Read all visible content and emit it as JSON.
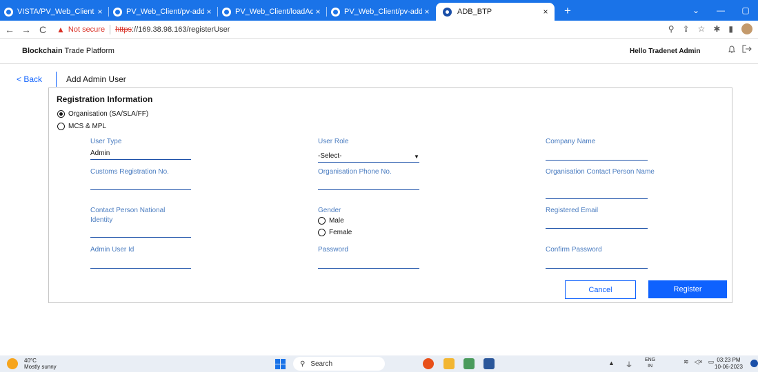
{
  "tabs": [
    {
      "title": "VISTA/PV_Web_Client at feat",
      "icon": "github-icon"
    },
    {
      "title": "PV_Web_Client/pv-address-",
      "icon": "github-icon"
    },
    {
      "title": "PV_Web_Client/loadAddress",
      "icon": "github-icon"
    },
    {
      "title": "PV_Web_Client/pv-address-",
      "icon": "github-icon"
    },
    {
      "title": "ADB_BTP",
      "icon": "app-favicon-icon"
    }
  ],
  "tab_close": "×",
  "new_tab": "+",
  "window_controls": {
    "dropdown": "⌄",
    "minimize": "—",
    "restore": "▢",
    "close": "✕"
  },
  "addressbar": {
    "back": "←",
    "forward": "→",
    "reload": "C",
    "security_text": "Not secure",
    "url_scheme": "https",
    "url_rest": "://169.38.98.163/registerUser"
  },
  "app": {
    "brand_bold": "Blockchain",
    "brand_rest": " Trade Platform",
    "greeting": "Hello Tradenet Admin"
  },
  "page": {
    "back_label": "< Back",
    "title": "Add Admin User"
  },
  "form": {
    "section_title": "Registration Information",
    "org_type_options": [
      {
        "label": "Organisation (SA/SLA/FF)",
        "selected": true
      },
      {
        "label": "MCS & MPL",
        "selected": false
      }
    ],
    "user_type": {
      "label": "User Type",
      "value": "Admin"
    },
    "user_role": {
      "label": "User Role",
      "value": "-Select-"
    },
    "company_name": {
      "label": "Company Name",
      "value": ""
    },
    "customs_registration": {
      "label": "Customs Registration No.",
      "value": ""
    },
    "org_phone": {
      "label": "Organisation Phone No.",
      "value": ""
    },
    "org_contact_person": {
      "label": "Organisation Contact Person Name",
      "value": ""
    },
    "contact_national_id": {
      "label": "Contact Person National Identity",
      "value": ""
    },
    "gender": {
      "label": "Gender",
      "options": [
        "Male",
        "Female"
      ]
    },
    "registered_email": {
      "label": "Registered Email",
      "value": ""
    },
    "admin_user_id": {
      "label": "Admin User Id",
      "value": ""
    },
    "password": {
      "label": "Password",
      "value": ""
    },
    "confirm_password": {
      "label": "Confirm Password",
      "value": ""
    },
    "cancel_label": "Cancel",
    "register_label": "Register"
  },
  "taskbar": {
    "temperature": "40°C",
    "weather": "Mostly sunny",
    "search_label": "Search",
    "lang_top": "ENG",
    "lang_bottom": "IN",
    "time": "03:23 PM",
    "date": "10-06-2023"
  },
  "colors": {
    "accent": "#0f62fe",
    "tabbar": "#1a73e8",
    "label": "#4a7cc0"
  }
}
